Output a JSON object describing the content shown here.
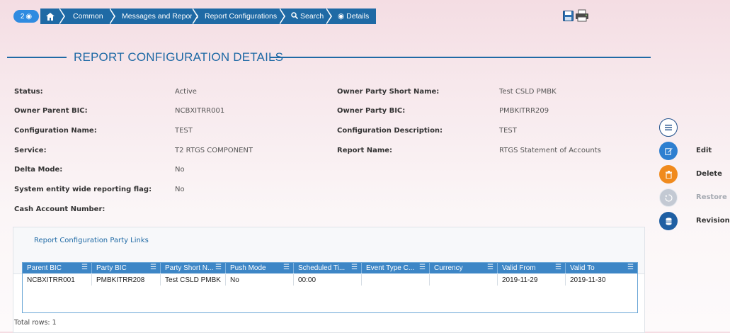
{
  "breadcrumb": {
    "badge": "2",
    "items": [
      "Common",
      "Messages and Reports",
      "Report Configurations",
      "Search",
      "Details"
    ]
  },
  "title": "REPORT CONFIGURATION DETAILS",
  "fields": [
    {
      "label": "Status:",
      "value": "Active"
    },
    {
      "label": "Owner Party Short Name:",
      "value": "Test CSLD PMBK"
    },
    {
      "label": "Owner Parent BIC:",
      "value": "NCBXITRR001"
    },
    {
      "label": "Owner Party BIC:",
      "value": "PMBKITRR209"
    },
    {
      "label": "Configuration Name:",
      "value": "TEST"
    },
    {
      "label": "Configuration Description:",
      "value": "TEST"
    },
    {
      "label": "Service:",
      "value": "T2 RTGS COMPONENT"
    },
    {
      "label": "Report Name:",
      "value": "RTGS Statement of Accounts"
    },
    {
      "label": "Delta Mode:",
      "value": "No"
    },
    {
      "label": "System entity wide reporting flag:",
      "value": "No"
    },
    {
      "label": "Cash Account Number:",
      "value": ""
    }
  ],
  "party_links": {
    "link_label": "Report Configuration Party Links",
    "columns": [
      "Parent BIC",
      "Party BIC",
      "Party Short N...",
      "Push Mode",
      "Scheduled Ti...",
      "Event Type C...",
      "Currency",
      "Valid From",
      "Valid To"
    ],
    "rows": [
      [
        "NCBXITRR001",
        "PMBKITRR208",
        "Test CSLD PMBK",
        "No",
        "00:00",
        "",
        "",
        "2019-11-29",
        "2019-11-30"
      ]
    ],
    "total": "Total rows: 1"
  },
  "actions": {
    "edit": "Edit",
    "delete": "Delete",
    "restore": "Restore",
    "revisions": "Revisions"
  },
  "colors": {
    "primary": "#1f6aa5",
    "delete": "#f08a1d",
    "disabled": "#b9c0cc"
  },
  "icons": [
    "eye-icon",
    "home-icon",
    "search-icon",
    "save-icon",
    "print-icon",
    "menu-icon",
    "edit-icon",
    "trash-icon",
    "restore-icon",
    "database-icon",
    "column-menu-icon"
  ]
}
